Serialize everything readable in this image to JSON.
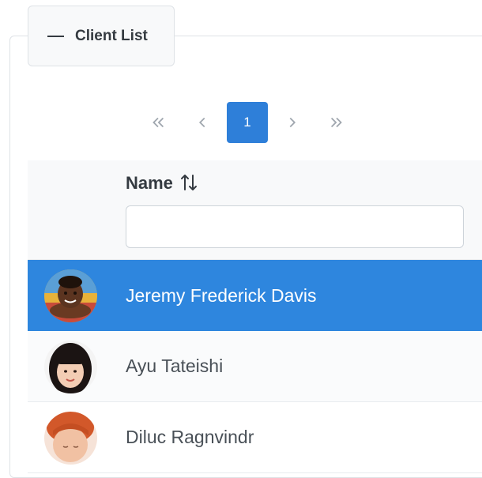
{
  "panel": {
    "legend_label": "Client List",
    "toggle_icon": "minus-icon"
  },
  "paginator": {
    "first_icon": "double-chevron-left-icon",
    "prev_icon": "chevron-left-icon",
    "current_page": "1",
    "next_icon": "chevron-right-icon",
    "last_icon": "double-chevron-right-icon"
  },
  "table": {
    "column_header": "Name",
    "sort_icon": "sort-arrows-icon",
    "filter_value": "",
    "filter_placeholder": "",
    "rows": [
      {
        "name": "Jeremy Frederick Davis",
        "avatar": "avatar-photo",
        "selected": true
      },
      {
        "name": "Ayu Tateishi",
        "avatar": "avatar-photo",
        "selected": false
      },
      {
        "name": "Diluc Ragnvindr",
        "avatar": "avatar-photo",
        "selected": false
      }
    ]
  },
  "colors": {
    "accent": "#2e86de",
    "active_page": "#2e7fd9",
    "header_bg": "#f8f9fa"
  }
}
